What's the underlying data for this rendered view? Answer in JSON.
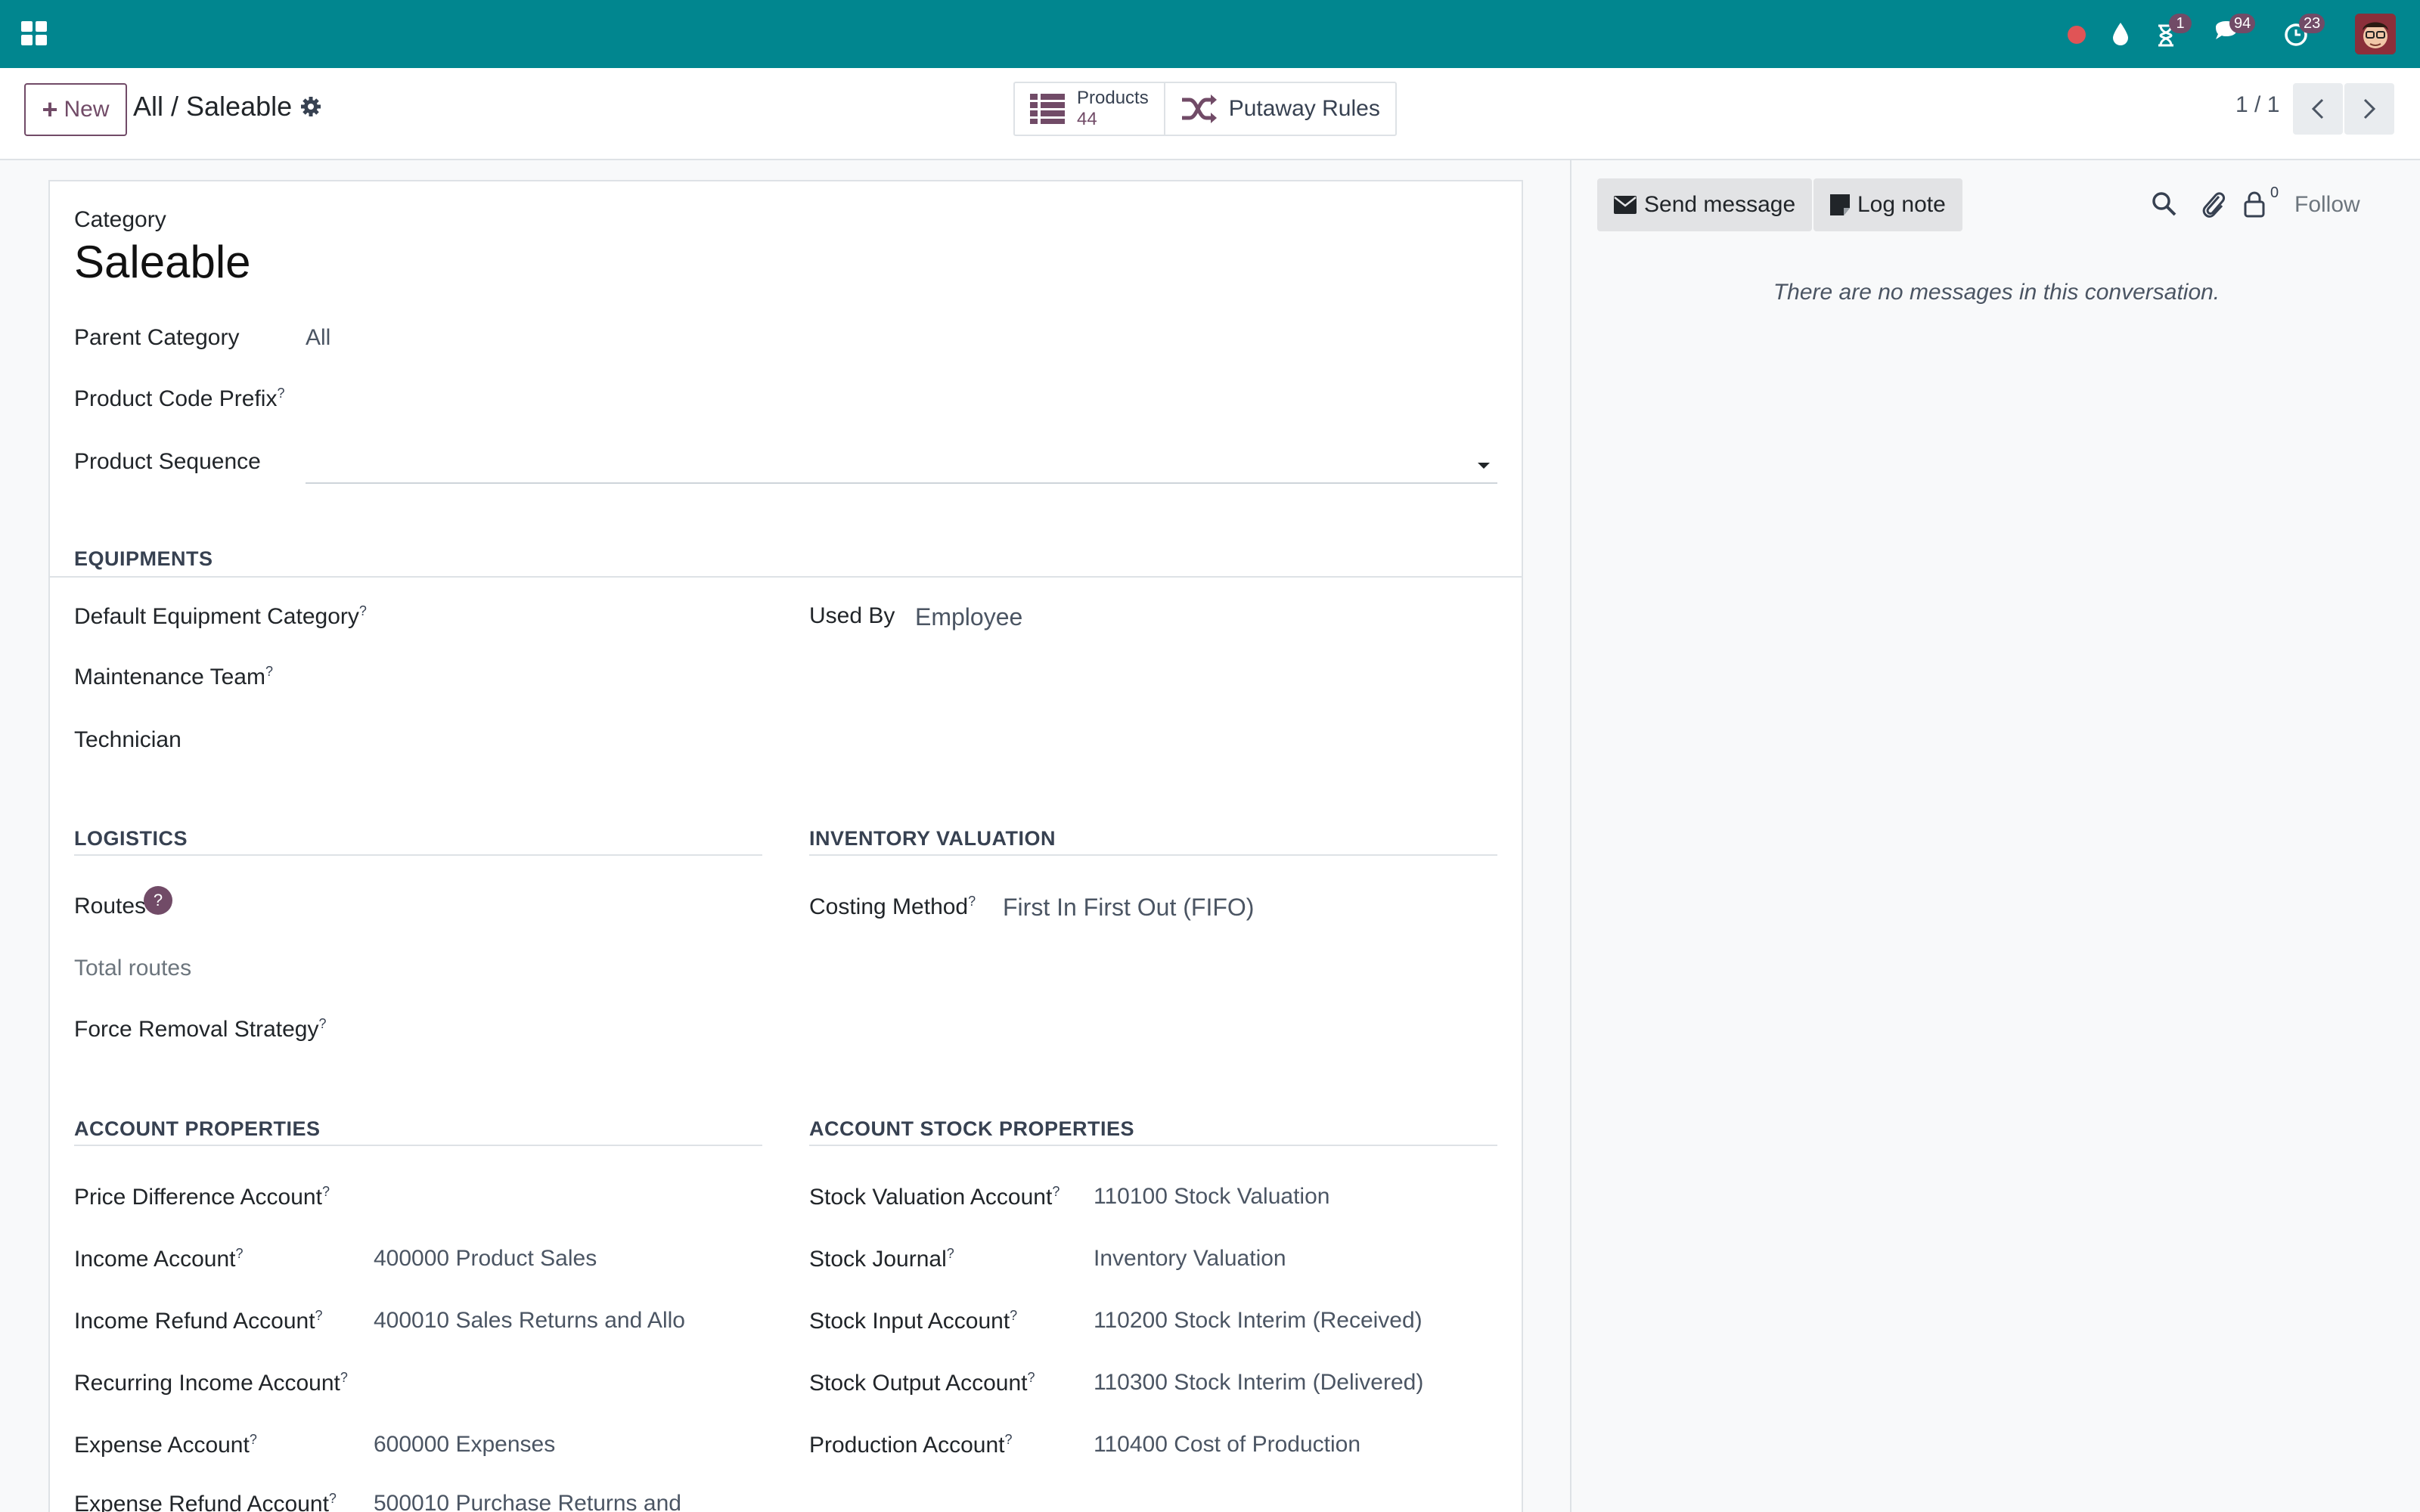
{
  "colors": {
    "navbar": "#01868f",
    "brand": "#714b67",
    "record_dot": "#e05456"
  },
  "navbar": {
    "apps_icon": "grid-icon",
    "tray": [
      {
        "name": "recording-dot-icon",
        "badge": ""
      },
      {
        "name": "droplet-icon",
        "badge": ""
      },
      {
        "name": "hourglass-icon",
        "badge": "1"
      },
      {
        "name": "chat-bubble-icon",
        "badge": "94"
      },
      {
        "name": "clock-icon",
        "badge": "23"
      }
    ]
  },
  "control": {
    "new_label": "New",
    "breadcrumb": "All / Saleable",
    "smart_buttons": [
      {
        "label": "Products",
        "value": "44",
        "icon": "list-icon"
      },
      {
        "label": "Putaway Rules",
        "icon": "shuffle-icon"
      }
    ],
    "pager": "1 / 1"
  },
  "form": {
    "category_label": "Category",
    "title": "Saleable",
    "parent_category_label": "Parent Category",
    "parent_category_value": "All",
    "product_code_prefix_label": "Product Code Prefix",
    "product_sequence_label": "Product Sequence",
    "equipments": {
      "title": "EQUIPMENTS",
      "default_equipment_category_label": "Default Equipment Category",
      "maintenance_team_label": "Maintenance Team",
      "technician_label": "Technician",
      "used_by_label": "Used By",
      "used_by_value": "Employee"
    },
    "logistics": {
      "title": "LOGISTICS",
      "routes_label": "Routes",
      "total_routes_label": "Total routes",
      "force_removal_strategy_label": "Force Removal Strategy"
    },
    "inventory_valuation": {
      "title": "INVENTORY VALUATION",
      "costing_method_label": "Costing Method",
      "costing_method_value": "First In First Out (FIFO)"
    },
    "account_properties": {
      "title": "ACCOUNT PROPERTIES",
      "rows": [
        {
          "label": "Price Difference Account",
          "value": ""
        },
        {
          "label": "Income Account",
          "value": "400000 Product Sales"
        },
        {
          "label": "Income Refund Account",
          "value": "400010 Sales Returns and Allo"
        },
        {
          "label": "Recurring Income Account",
          "value": ""
        },
        {
          "label": "Expense Account",
          "value": "600000 Expenses"
        },
        {
          "label": "Expense Refund Account",
          "value": "500010 Purchase Returns and"
        }
      ]
    },
    "account_stock_properties": {
      "title": "ACCOUNT STOCK PROPERTIES",
      "rows": [
        {
          "label": "Stock Valuation Account",
          "value": "110100 Stock Valuation"
        },
        {
          "label": "Stock Journal",
          "value": "Inventory Valuation"
        },
        {
          "label": "Stock Input Account",
          "value": "110200 Stock Interim (Received)"
        },
        {
          "label": "Stock Output Account",
          "value": "110300 Stock Interim (Delivered)"
        },
        {
          "label": "Production Account",
          "value": "110400 Cost of Production"
        }
      ]
    },
    "help_mark": "?"
  },
  "chatter": {
    "send_message_label": "Send message",
    "log_note_label": "Log note",
    "followers_count": "0",
    "follow_label": "Follow",
    "empty_message": "There are no messages in this conversation."
  }
}
